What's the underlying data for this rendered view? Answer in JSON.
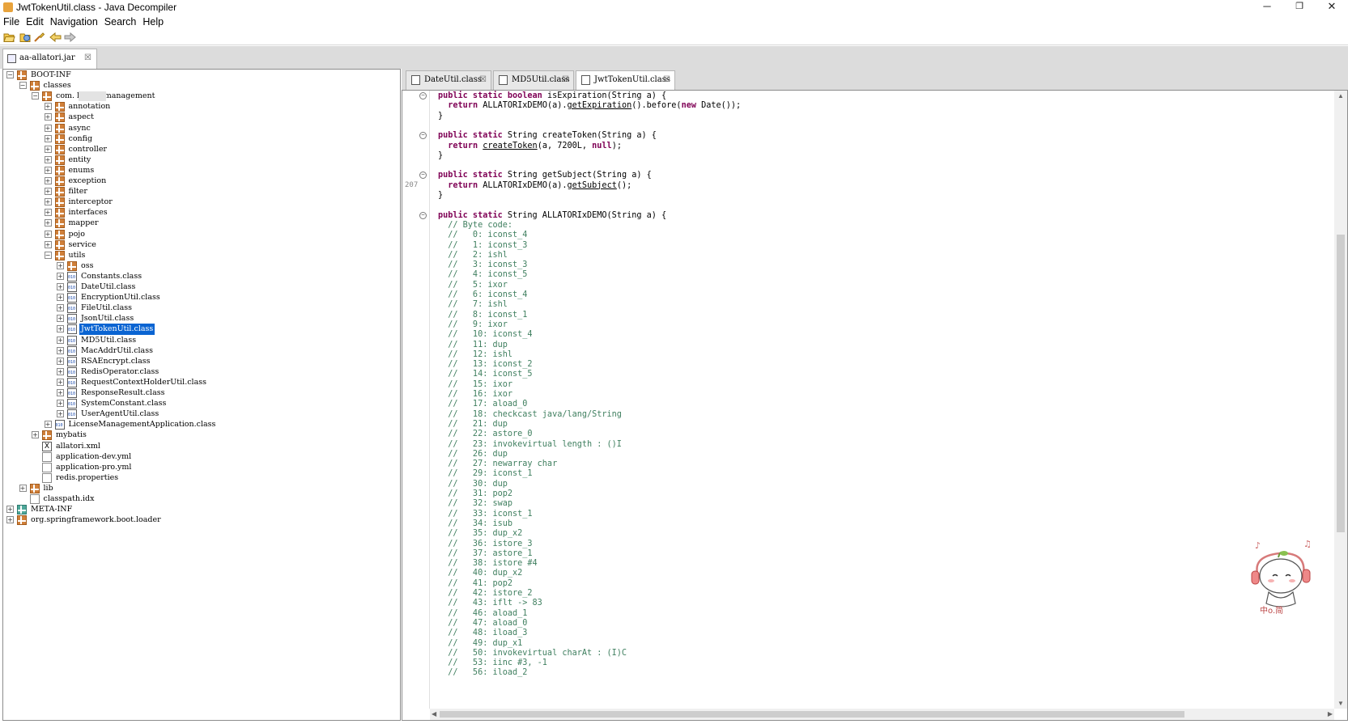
{
  "window": {
    "title": "JwtTokenUtil.class - Java Decompiler",
    "minimize": "─",
    "restore": "❐",
    "close": "✕"
  },
  "menu": [
    "File",
    "Edit",
    "Navigation",
    "Search",
    "Help"
  ],
  "toolbar": [
    "open-folder-icon",
    "open-type-icon",
    "search-icon",
    "back-arrow-icon",
    "forward-arrow-icon"
  ],
  "jar_tab": {
    "label": "aa-allatori.jar",
    "close": "☒"
  },
  "tree": [
    {
      "depth": 0,
      "exp": "−",
      "icon": "pkg",
      "label": "BOOT-INF"
    },
    {
      "depth": 1,
      "exp": "−",
      "icon": "pkg",
      "label": "classes"
    },
    {
      "depth": 2,
      "exp": "−",
      "icon": "pkg",
      "label": "com.        licensemanagement",
      "redact": true
    },
    {
      "depth": 3,
      "exp": "+",
      "icon": "pkg",
      "label": "annotation"
    },
    {
      "depth": 3,
      "exp": "+",
      "icon": "pkg",
      "label": "aspect"
    },
    {
      "depth": 3,
      "exp": "+",
      "icon": "pkg",
      "label": "async"
    },
    {
      "depth": 3,
      "exp": "+",
      "icon": "pkg",
      "label": "config"
    },
    {
      "depth": 3,
      "exp": "+",
      "icon": "pkg",
      "label": "controller"
    },
    {
      "depth": 3,
      "exp": "+",
      "icon": "pkg",
      "label": "entity"
    },
    {
      "depth": 3,
      "exp": "+",
      "icon": "pkg",
      "label": "enums"
    },
    {
      "depth": 3,
      "exp": "+",
      "icon": "pkg",
      "label": "exception"
    },
    {
      "depth": 3,
      "exp": "+",
      "icon": "pkg",
      "label": "filter"
    },
    {
      "depth": 3,
      "exp": "+",
      "icon": "pkg",
      "label": "interceptor"
    },
    {
      "depth": 3,
      "exp": "+",
      "icon": "pkg",
      "label": "interfaces"
    },
    {
      "depth": 3,
      "exp": "+",
      "icon": "pkg",
      "label": "mapper"
    },
    {
      "depth": 3,
      "exp": "+",
      "icon": "pkg",
      "label": "pojo"
    },
    {
      "depth": 3,
      "exp": "+",
      "icon": "pkg",
      "label": "service"
    },
    {
      "depth": 3,
      "exp": "−",
      "icon": "pkg",
      "label": "utils"
    },
    {
      "depth": 4,
      "exp": "+",
      "icon": "pkg",
      "label": "oss"
    },
    {
      "depth": 4,
      "exp": "+",
      "icon": "class",
      "label": "Constants.class"
    },
    {
      "depth": 4,
      "exp": "+",
      "icon": "class",
      "label": "DateUtil.class"
    },
    {
      "depth": 4,
      "exp": "+",
      "icon": "class",
      "label": "EncryptionUtil.class"
    },
    {
      "depth": 4,
      "exp": "+",
      "icon": "class",
      "label": "FileUtil.class"
    },
    {
      "depth": 4,
      "exp": "+",
      "icon": "class",
      "label": "JsonUtil.class"
    },
    {
      "depth": 4,
      "exp": "+",
      "icon": "class",
      "label": "JwtTokenUtil.class",
      "selected": true
    },
    {
      "depth": 4,
      "exp": "+",
      "icon": "class",
      "label": "MD5Util.class"
    },
    {
      "depth": 4,
      "exp": "+",
      "icon": "class",
      "label": "MacAddrUtil.class"
    },
    {
      "depth": 4,
      "exp": "+",
      "icon": "class",
      "label": "RSAEncrypt.class"
    },
    {
      "depth": 4,
      "exp": "+",
      "icon": "class",
      "label": "RedisOperator.class"
    },
    {
      "depth": 4,
      "exp": "+",
      "icon": "class",
      "label": "RequestContextHolderUtil.class"
    },
    {
      "depth": 4,
      "exp": "+",
      "icon": "class",
      "label": "ResponseResult.class"
    },
    {
      "depth": 4,
      "exp": "+",
      "icon": "class",
      "label": "SystemConstant.class"
    },
    {
      "depth": 4,
      "exp": "+",
      "icon": "class",
      "label": "UserAgentUtil.class"
    },
    {
      "depth": 3,
      "exp": "+",
      "icon": "class",
      "label": "LicenseManagementApplication.class"
    },
    {
      "depth": 2,
      "exp": "+",
      "icon": "pkg",
      "label": "mybatis"
    },
    {
      "depth": 2,
      "exp": "",
      "icon": "xml",
      "label": "allatori.xml"
    },
    {
      "depth": 2,
      "exp": "",
      "icon": "file",
      "label": "application-dev.yml"
    },
    {
      "depth": 2,
      "exp": "",
      "icon": "file",
      "label": "application-pro.yml"
    },
    {
      "depth": 2,
      "exp": "",
      "icon": "file",
      "label": "redis.properties"
    },
    {
      "depth": 1,
      "exp": "+",
      "icon": "pkg",
      "label": "lib"
    },
    {
      "depth": 1,
      "exp": "",
      "icon": "file",
      "label": "classpath.idx"
    },
    {
      "depth": 0,
      "exp": "+",
      "icon": "meta",
      "label": "META-INF"
    },
    {
      "depth": 0,
      "exp": "+",
      "icon": "pkg",
      "label": "org.springframework.boot.loader"
    }
  ],
  "editor_tabs": [
    {
      "label": "DateUtil.class",
      "close": "☒",
      "active": false
    },
    {
      "label": "MD5Util.class",
      "close": "☒",
      "active": false
    },
    {
      "label": "JwtTokenUtil.class",
      "close": "☒",
      "active": true
    }
  ],
  "gutter": {
    "line_numbers": [
      {
        "line": 9,
        "text": "207"
      }
    ],
    "folds": [
      0,
      4,
      8,
      12
    ]
  },
  "code_lines": [
    [
      [
        "kw",
        "public static boolean "
      ],
      [
        "",
        "isExpiration(String a) {"
      ]
    ],
    [
      [
        "",
        "  "
      ],
      [
        "kw",
        "return "
      ],
      [
        "",
        "ALLATORIxDEMO(a)."
      ],
      [
        "ul",
        "getExpiration"
      ],
      [
        "",
        "().before("
      ],
      [
        "kw",
        "new "
      ],
      [
        "",
        "Date());"
      ]
    ],
    [
      [
        "",
        "}"
      ]
    ],
    [
      [
        "",
        ""
      ]
    ],
    [
      [
        "kw",
        "public static "
      ],
      [
        "",
        "String createToken(String a) {"
      ]
    ],
    [
      [
        "",
        "  "
      ],
      [
        "kw",
        "return "
      ],
      [
        "ul",
        "createToken"
      ],
      [
        "",
        "(a, 7200L, "
      ],
      [
        "kw",
        "null"
      ],
      [
        "",
        ");"
      ]
    ],
    [
      [
        "",
        "}"
      ]
    ],
    [
      [
        "",
        ""
      ]
    ],
    [
      [
        "kw",
        "public static "
      ],
      [
        "",
        "String getSubject(String a) {"
      ]
    ],
    [
      [
        "",
        "  "
      ],
      [
        "kw",
        "return "
      ],
      [
        "",
        "ALLATORIxDEMO(a)."
      ],
      [
        "ul",
        "getSubject"
      ],
      [
        "",
        "();"
      ]
    ],
    [
      [
        "",
        "}"
      ]
    ],
    [
      [
        "",
        ""
      ]
    ],
    [
      [
        "kw",
        "public static "
      ],
      [
        "",
        "String ALLATORIxDEMO(String a) {"
      ]
    ],
    [
      [
        "cm",
        "  // Byte code:"
      ]
    ],
    [
      [
        "cm",
        "  //   0: iconst_4"
      ]
    ],
    [
      [
        "cm",
        "  //   1: iconst_3"
      ]
    ],
    [
      [
        "cm",
        "  //   2: ishl"
      ]
    ],
    [
      [
        "cm",
        "  //   3: iconst_3"
      ]
    ],
    [
      [
        "cm",
        "  //   4: iconst_5"
      ]
    ],
    [
      [
        "cm",
        "  //   5: ixor"
      ]
    ],
    [
      [
        "cm",
        "  //   6: iconst_4"
      ]
    ],
    [
      [
        "cm",
        "  //   7: ishl"
      ]
    ],
    [
      [
        "cm",
        "  //   8: iconst_1"
      ]
    ],
    [
      [
        "cm",
        "  //   9: ixor"
      ]
    ],
    [
      [
        "cm",
        "  //   10: iconst_4"
      ]
    ],
    [
      [
        "cm",
        "  //   11: dup"
      ]
    ],
    [
      [
        "cm",
        "  //   12: ishl"
      ]
    ],
    [
      [
        "cm",
        "  //   13: iconst_2"
      ]
    ],
    [
      [
        "cm",
        "  //   14: iconst_5"
      ]
    ],
    [
      [
        "cm",
        "  //   15: ixor"
      ]
    ],
    [
      [
        "cm",
        "  //   16: ixor"
      ]
    ],
    [
      [
        "cm",
        "  //   17: aload_0"
      ]
    ],
    [
      [
        "cm",
        "  //   18: checkcast java/lang/String"
      ]
    ],
    [
      [
        "cm",
        "  //   21: dup"
      ]
    ],
    [
      [
        "cm",
        "  //   22: astore_0"
      ]
    ],
    [
      [
        "cm",
        "  //   23: invokevirtual length : ()I"
      ]
    ],
    [
      [
        "cm",
        "  //   26: dup"
      ]
    ],
    [
      [
        "cm",
        "  //   27: newarray char"
      ]
    ],
    [
      [
        "cm",
        "  //   29: iconst_1"
      ]
    ],
    [
      [
        "cm",
        "  //   30: dup"
      ]
    ],
    [
      [
        "cm",
        "  //   31: pop2"
      ]
    ],
    [
      [
        "cm",
        "  //   32: swap"
      ]
    ],
    [
      [
        "cm",
        "  //   33: iconst_1"
      ]
    ],
    [
      [
        "cm",
        "  //   34: isub"
      ]
    ],
    [
      [
        "cm",
        "  //   35: dup_x2"
      ]
    ],
    [
      [
        "cm",
        "  //   36: istore_3"
      ]
    ],
    [
      [
        "cm",
        "  //   37: astore_1"
      ]
    ],
    [
      [
        "cm",
        "  //   38: istore #4"
      ]
    ],
    [
      [
        "cm",
        "  //   40: dup_x2"
      ]
    ],
    [
      [
        "cm",
        "  //   41: pop2"
      ]
    ],
    [
      [
        "cm",
        "  //   42: istore_2"
      ]
    ],
    [
      [
        "cm",
        "  //   43: iflt -> 83"
      ]
    ],
    [
      [
        "cm",
        "  //   46: aload_1"
      ]
    ],
    [
      [
        "cm",
        "  //   47: aload_0"
      ]
    ],
    [
      [
        "cm",
        "  //   48: iload_3"
      ]
    ],
    [
      [
        "cm",
        "  //   49: dup_x1"
      ]
    ],
    [
      [
        "cm",
        "  //   50: invokevirtual charAt : (I)C"
      ]
    ],
    [
      [
        "cm",
        "  //   53: iinc #3, -1"
      ]
    ],
    [
      [
        "cm",
        "  //   56: iload_2"
      ]
    ]
  ],
  "mascot": {
    "caption": "中o.简"
  }
}
